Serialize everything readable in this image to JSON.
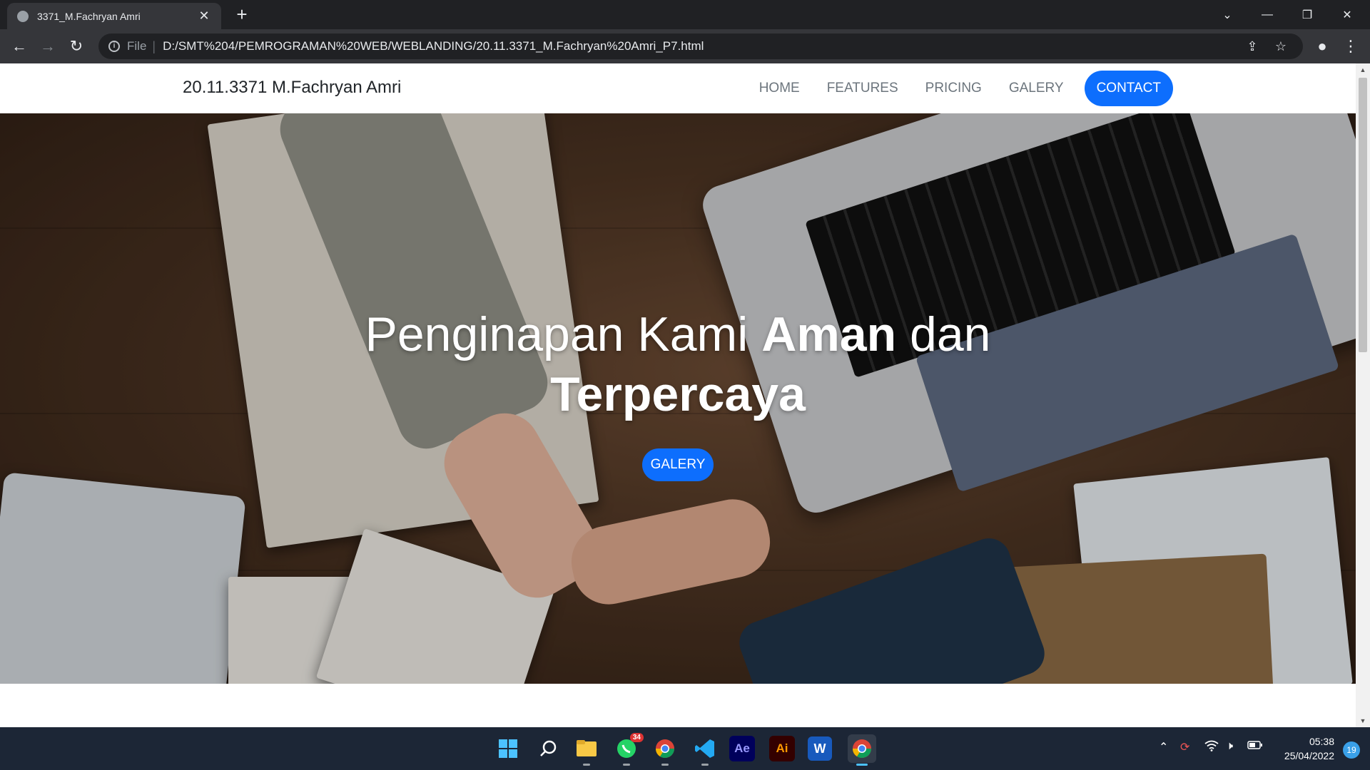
{
  "browser": {
    "tab_title": "3371_M.Fachryan Amri",
    "tab_close": "✕",
    "new_tab": "+",
    "scheme_label": "File",
    "url": "D:/SMT%204/PEMROGRAMAN%20WEB/WEBLANDING/20.11.3371_M.Fachryan%20Amri_P7.html"
  },
  "site": {
    "brand": "20.11.3371 M.Fachryan Amri",
    "nav": [
      "HOME",
      "FEATURES",
      "PRICING",
      "GALERY",
      "CONTACT"
    ]
  },
  "hero": {
    "headline_part1": "Penginapan Kami ",
    "headline_bold1": "Aman",
    "headline_part2": " dan",
    "headline_bold2": "Terpercaya",
    "button_label": "GALERY"
  },
  "taskbar": {
    "whatsapp_badge": "34",
    "time": "05:38",
    "date": "25/04/2022",
    "notifications": "19",
    "ae_label": "Ae",
    "ai_label": "Ai",
    "word_label": "W"
  },
  "colors": {
    "primary": "#0d6efd",
    "nav_text": "#6c757d"
  }
}
